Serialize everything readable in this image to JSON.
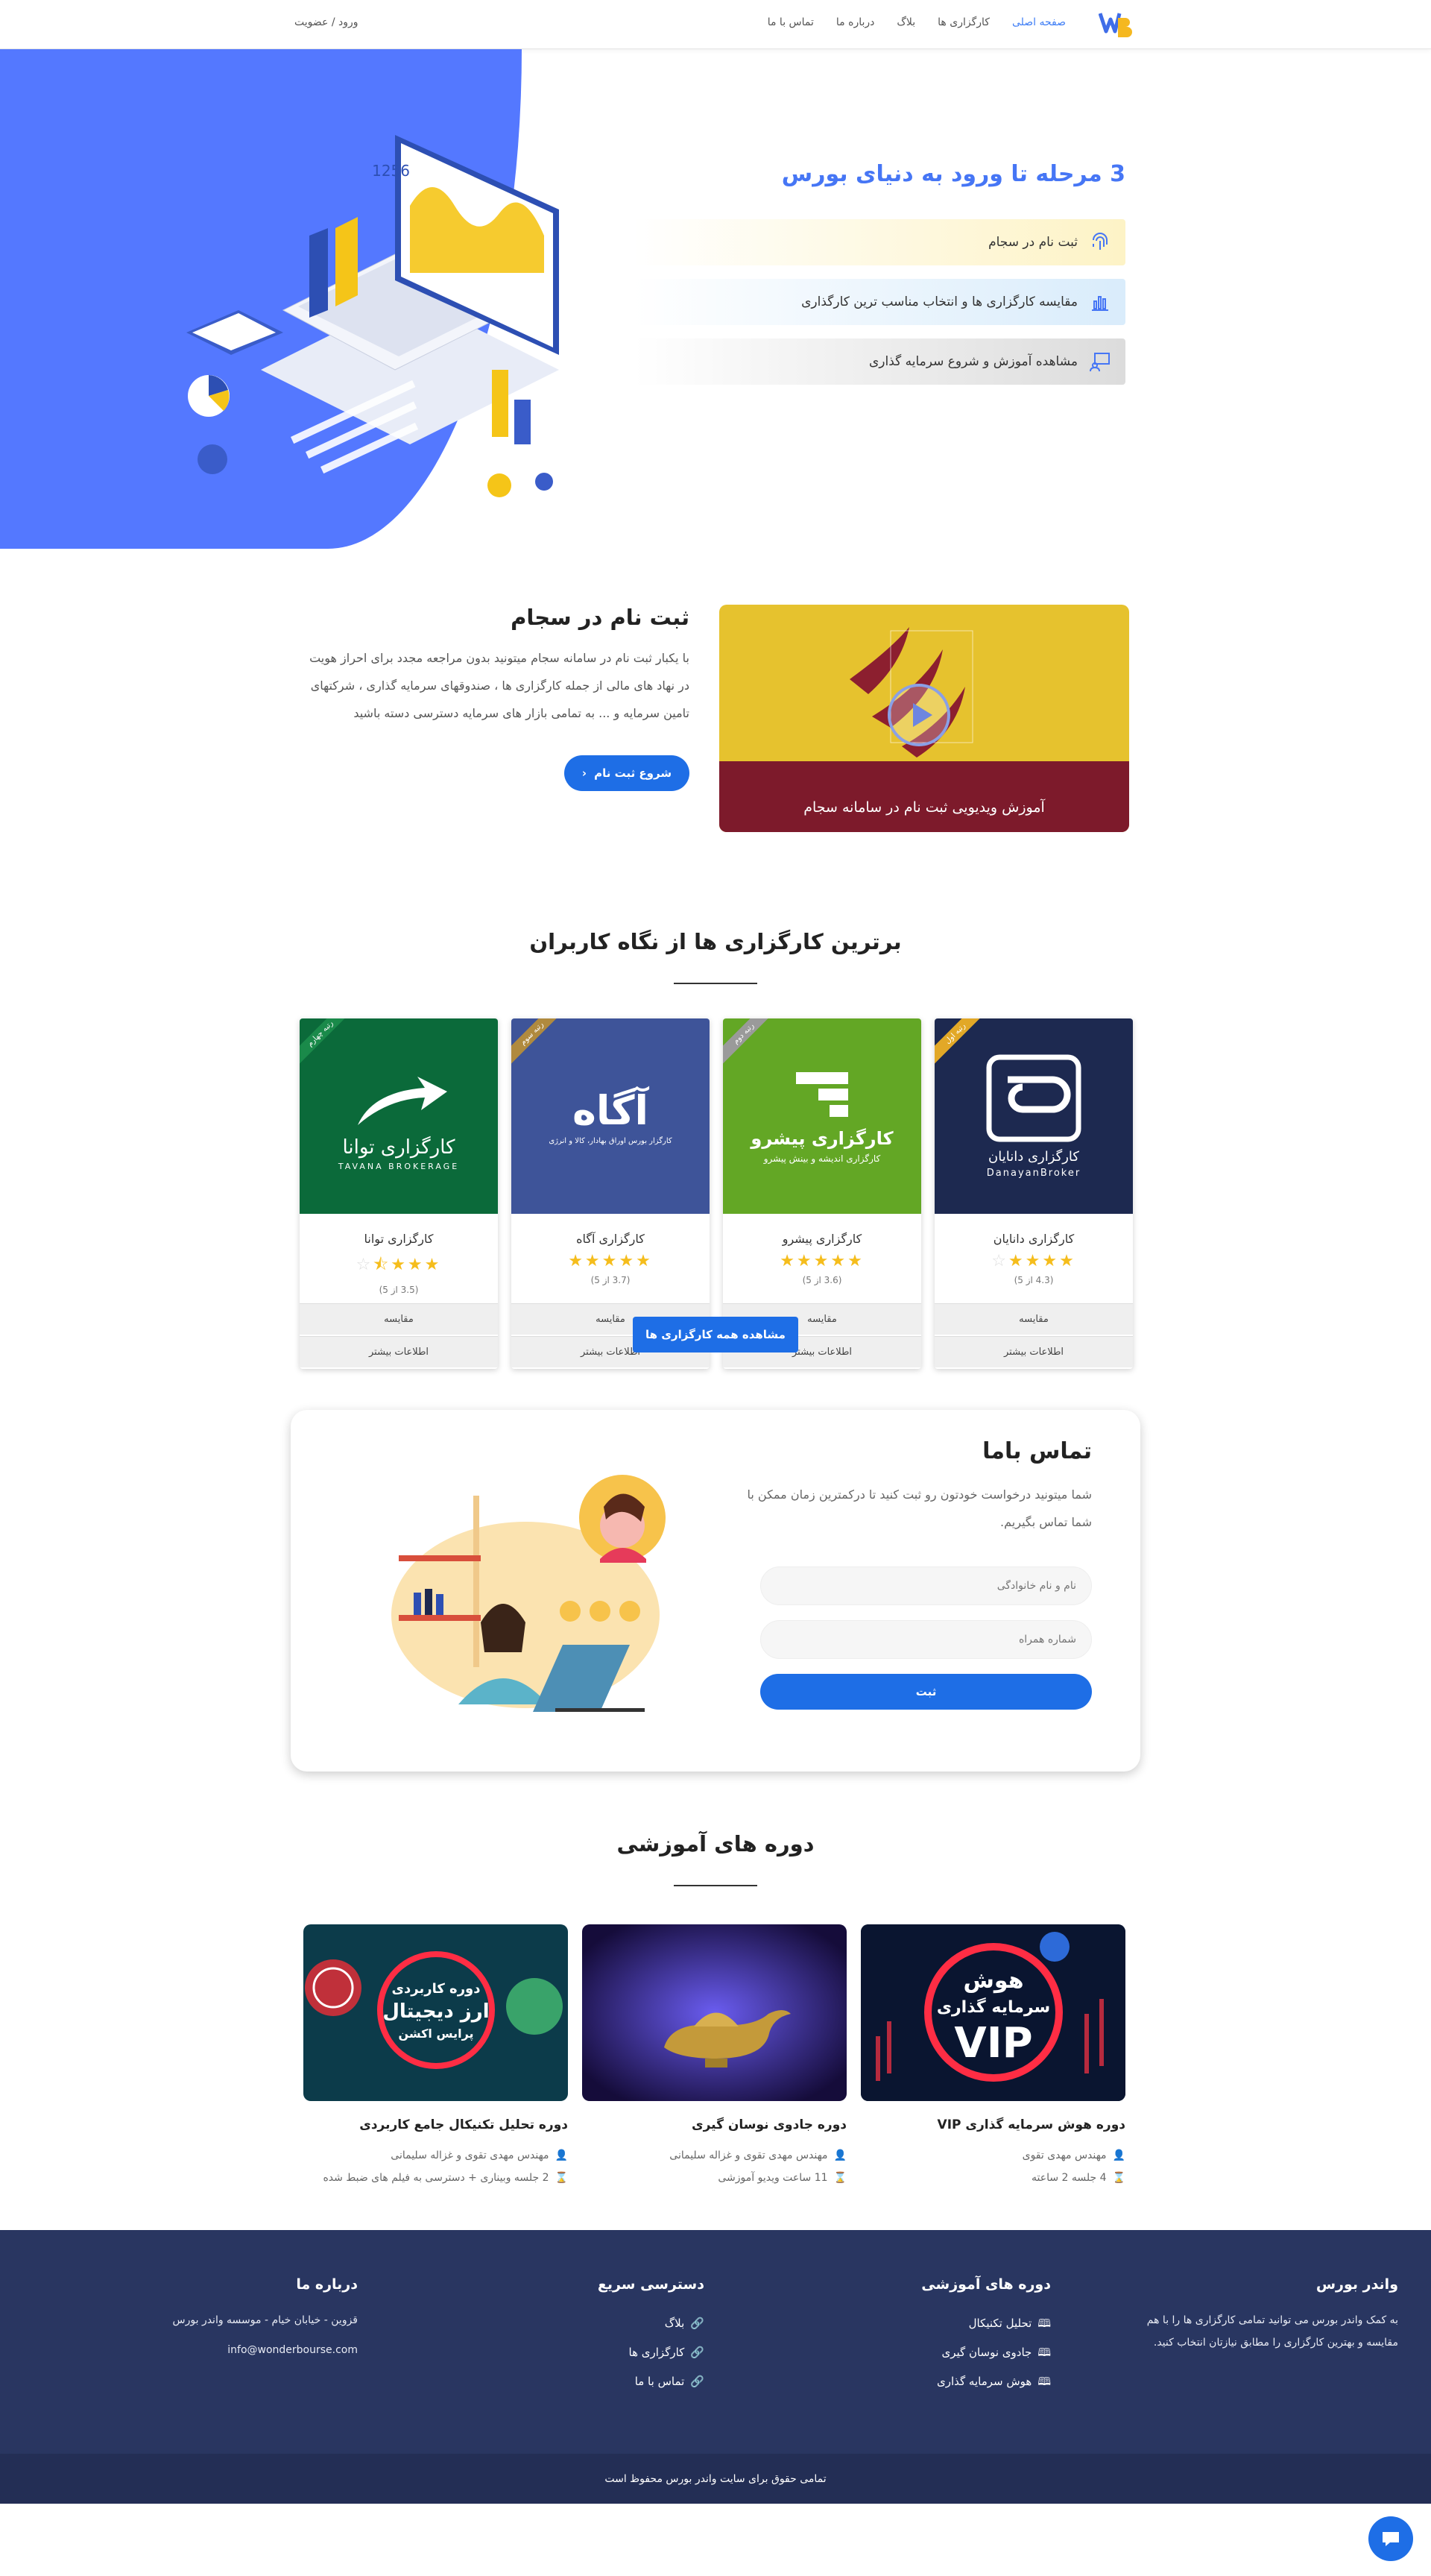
{
  "header": {
    "nav": [
      "صفحه اصلی",
      "کارگزاری ها",
      "بلاگ",
      "درباره ما",
      "تماس با ما"
    ],
    "login": "ورود / عضویت",
    "colors": {
      "accent": "#3f7ef5",
      "brand_blue": "#1e6ee6"
    }
  },
  "hero": {
    "title": "3 مرحله تا ورود به دنیای بورس",
    "steps": [
      {
        "label": "ثبت نام در سجام",
        "icon": "fingerprint-icon"
      },
      {
        "label": "مقایسه کارگزاری ها و انتخاب مناسب ترین کارگذاری",
        "icon": "bar-chart-icon"
      },
      {
        "label": "مشاهده آموزش و شروع سرمایه گذاری",
        "icon": "teacher-icon"
      }
    ],
    "art_number": "1256"
  },
  "sejam": {
    "title": "ثبت نام در سجام",
    "text": "با یکبار ثبت نام در سامانه سجام میتونید بدون مراجعه مجدد برای احراز هویت در نهاد های مالی از جمله کارگزاری ها ، صندوقهای سرمایه گذاری ، شرکتهای تامین سرمایه و ... به تمامی بازار های سرمایه دسترسی دسته باشید",
    "button": "شروع ثبت نام",
    "video_caption": "آموزش ویدیویی ثبت نام در سامانه سجام"
  },
  "brokers": {
    "title": "برترین کارگزاری ها از نگاه کاربران",
    "cards": [
      {
        "name": "کارگزاری دانایان",
        "rank": "رتبه اول",
        "rating": "(4.3 از 5)",
        "stars": 4.3,
        "logo_text": "کارگزاری دانایان",
        "logo_sub": "DanayanBroker",
        "bg": "#1d2950",
        "ribbon": "#e2a827"
      },
      {
        "name": "کارگزاری پیشرو",
        "rank": "رتبه دوم",
        "rating": "(3.6 از 5)",
        "stars": 3.6,
        "logo_text": "کارگزاری پیشرو",
        "logo_sub": "کارگزاری اندیشه و بینش پیشرو",
        "bg": "#63a725",
        "ribbon": "#9a9a9a"
      },
      {
        "name": "کارگزاری آگاه",
        "rank": "رتبه سوم",
        "rating": "(3.7 از 5)",
        "stars": 3.7,
        "logo_text": "آگاه",
        "logo_sub": "کارگزار بورس اوراق بهادار، کالا و انرژی",
        "bg": "#3e5499",
        "ribbon": "#b08a3e"
      },
      {
        "name": "کارگزاری توانا",
        "rank": "رتبه چهارم",
        "rating": "(3.5 از 5)",
        "stars": 3.5,
        "logo_text": "کارگزاری توانا",
        "logo_sub": "TAVANA BROKERAGE",
        "bg": "#0b6a3a",
        "ribbon": "#1a8a4a"
      }
    ],
    "compare": "مقایسه",
    "more": "اطلاعات بیشتر",
    "all_button": "مشاهده همه کارگزاری ها"
  },
  "contact": {
    "title": "تماس باما",
    "text": "شما میتونید درخواست خودتون رو ثبت کنید تا درکمترین زمان ممکن با شما تماس بگیریم.",
    "name_placeholder": "نام و نام خانوادگی",
    "phone_placeholder": "شماره همراه",
    "submit": "ثبت"
  },
  "courses": {
    "title": "دوره های آموزشی",
    "items": [
      {
        "title": "دوره هوش سرمایه گذاری VIP",
        "teacher": "مهندس مهدی تقوی",
        "duration": "4 جلسه 2 ساعته",
        "img_line1": "هوش",
        "img_line2": "سرمایه گذاری",
        "img_line3": "VIP"
      },
      {
        "title": "دوره جادوی نوسان گیری",
        "teacher": "مهندس مهدی تقوی و غزاله سلیمانی",
        "duration": "11 ساعت ویدیو آموزشی"
      },
      {
        "title": "دوره تحلیل تکنیکال جامع کاربردی",
        "teacher": "مهندس مهدی تقوی و غزاله سلیمانی",
        "duration": "2 جلسه وبیناری + دسترسی به فیلم های ضبط شده",
        "img_line1": "دوره کاربردی",
        "img_line2": "ارز دیجیتال",
        "img_line3": "پرایس اکشن"
      }
    ]
  },
  "footer": {
    "about_title": "واندر بورس",
    "about_text": "به کمک واندر بورس می توانید تمامی کارگزاری ها را با هم مقایسه و بهترین کارگزاری را مطابق نیازتان انتخاب کنید.",
    "courses_title": "دوره های آموزشی",
    "courses_links": [
      "تحلیل تکنیکال",
      "جادوی نوسان گیری",
      "هوش سرمایه گذاری"
    ],
    "quick_title": "دسترسی سریع",
    "quick_links": [
      "بلاگ",
      "کارگزاری ها",
      "تماس با ما"
    ],
    "contact_title": "درباره ما",
    "address": "قزوین - خیابان خیام - موسسه واندر بورس",
    "email": "info@wonderbourse.com",
    "copyright": "تمامی حقوق برای سایت واندر بورس محفوظ است"
  }
}
